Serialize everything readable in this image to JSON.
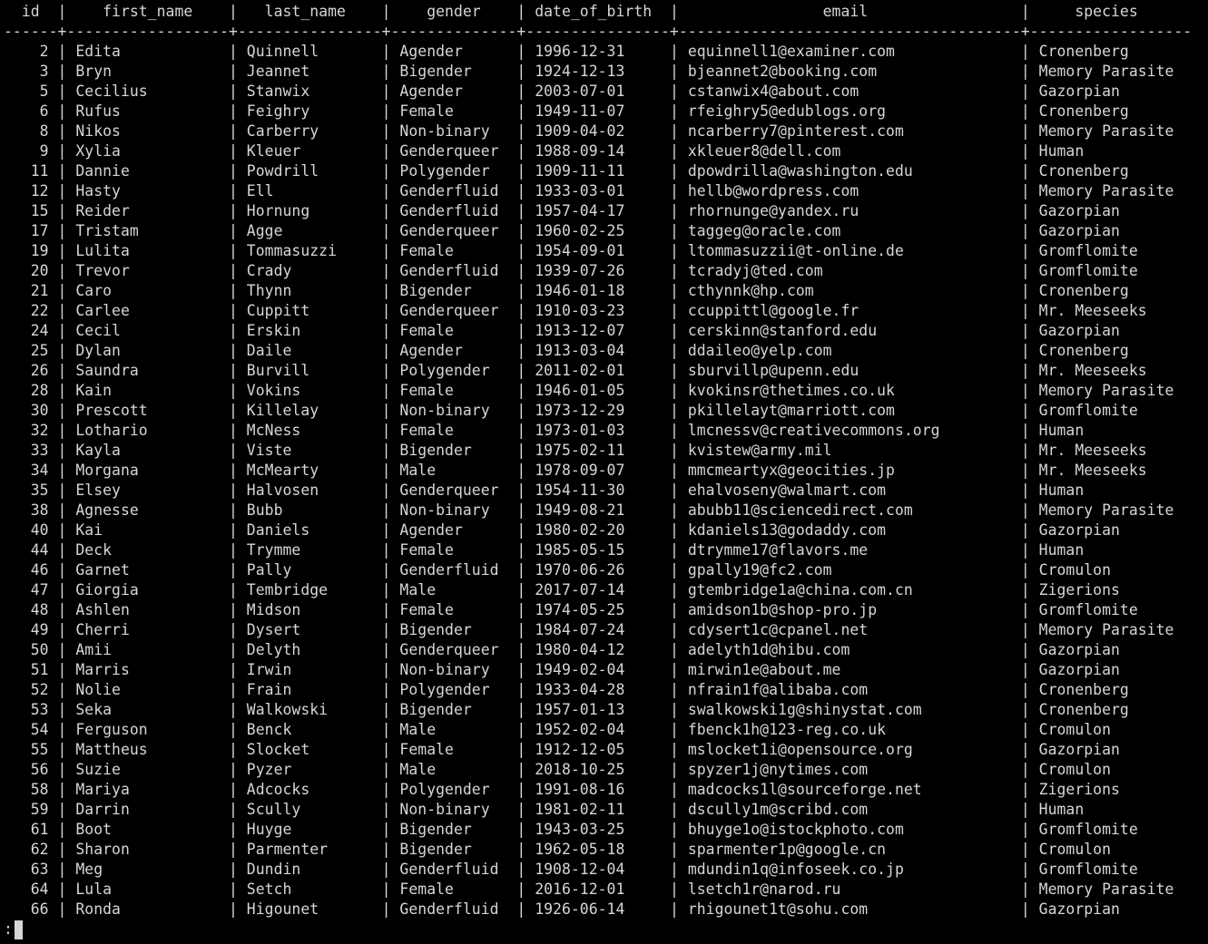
{
  "terminal": {
    "prompt": ":",
    "colors": {
      "background": "#000000",
      "text": "#d6d6d6"
    }
  },
  "table": {
    "columns": [
      {
        "key": "id",
        "label": "id",
        "width": 6,
        "align": "right"
      },
      {
        "key": "first_name",
        "label": "first_name",
        "width": 18,
        "align": "left"
      },
      {
        "key": "last_name",
        "label": "last_name",
        "width": 16,
        "align": "left"
      },
      {
        "key": "gender",
        "label": "gender",
        "width": 14,
        "align": "left"
      },
      {
        "key": "date_of_birth",
        "label": "date_of_birth",
        "width": 16,
        "align": "left"
      },
      {
        "key": "email",
        "label": "email",
        "width": 38,
        "align": "left"
      },
      {
        "key": "species",
        "label": "species",
        "width": 18,
        "align": "left"
      }
    ],
    "rows": [
      [
        "2",
        "Edita",
        "Quinnell",
        "Agender",
        "1996-12-31",
        "equinnell1@examiner.com",
        "Cronenberg"
      ],
      [
        "3",
        "Bryn",
        "Jeannet",
        "Bigender",
        "1924-12-13",
        "bjeannet2@booking.com",
        "Memory Parasite"
      ],
      [
        "5",
        "Cecilius",
        "Stanwix",
        "Agender",
        "2003-07-01",
        "cstanwix4@about.com",
        "Gazorpian"
      ],
      [
        "6",
        "Rufus",
        "Feighry",
        "Female",
        "1949-11-07",
        "rfeighry5@edublogs.org",
        "Cronenberg"
      ],
      [
        "8",
        "Nikos",
        "Carberry",
        "Non-binary",
        "1909-04-02",
        "ncarberry7@pinterest.com",
        "Memory Parasite"
      ],
      [
        "9",
        "Xylia",
        "Kleuer",
        "Genderqueer",
        "1988-09-14",
        "xkleuer8@dell.com",
        "Human"
      ],
      [
        "11",
        "Dannie",
        "Powdrill",
        "Polygender",
        "1909-11-11",
        "dpowdrilla@washington.edu",
        "Cronenberg"
      ],
      [
        "12",
        "Hasty",
        "Ell",
        "Genderfluid",
        "1933-03-01",
        "hellb@wordpress.com",
        "Memory Parasite"
      ],
      [
        "15",
        "Reider",
        "Hornung",
        "Genderfluid",
        "1957-04-17",
        "rhornunge@yandex.ru",
        "Gazorpian"
      ],
      [
        "17",
        "Tristam",
        "Agge",
        "Genderqueer",
        "1960-02-25",
        "taggeg@oracle.com",
        "Gazorpian"
      ],
      [
        "19",
        "Lulita",
        "Tommasuzzi",
        "Female",
        "1954-09-01",
        "ltommasuzzii@t-online.de",
        "Gromflomite"
      ],
      [
        "20",
        "Trevor",
        "Crady",
        "Genderfluid",
        "1939-07-26",
        "tcradyj@ted.com",
        "Gromflomite"
      ],
      [
        "21",
        "Caro",
        "Thynn",
        "Bigender",
        "1946-01-18",
        "cthynnk@hp.com",
        "Cronenberg"
      ],
      [
        "22",
        "Carlee",
        "Cuppitt",
        "Genderqueer",
        "1910-03-23",
        "ccuppittl@google.fr",
        "Mr. Meeseeks"
      ],
      [
        "24",
        "Cecil",
        "Erskin",
        "Female",
        "1913-12-07",
        "cerskinn@stanford.edu",
        "Gazorpian"
      ],
      [
        "25",
        "Dylan",
        "Daile",
        "Agender",
        "1913-03-04",
        "ddaileo@yelp.com",
        "Cronenberg"
      ],
      [
        "26",
        "Saundra",
        "Burvill",
        "Polygender",
        "2011-02-01",
        "sburvillp@upenn.edu",
        "Mr. Meeseeks"
      ],
      [
        "28",
        "Kain",
        "Vokins",
        "Female",
        "1946-01-05",
        "kvokinsr@thetimes.co.uk",
        "Memory Parasite"
      ],
      [
        "30",
        "Prescott",
        "Killelay",
        "Non-binary",
        "1973-12-29",
        "pkillelayt@marriott.com",
        "Gromflomite"
      ],
      [
        "32",
        "Lothario",
        "McNess",
        "Female",
        "1973-01-03",
        "lmcnessv@creativecommons.org",
        "Human"
      ],
      [
        "33",
        "Kayla",
        "Viste",
        "Bigender",
        "1975-02-11",
        "kvistew@army.mil",
        "Mr. Meeseeks"
      ],
      [
        "34",
        "Morgana",
        "McMearty",
        "Male",
        "1978-09-07",
        "mmcmeartyx@geocities.jp",
        "Mr. Meeseeks"
      ],
      [
        "35",
        "Elsey",
        "Halvosen",
        "Genderqueer",
        "1954-11-30",
        "ehalvoseny@walmart.com",
        "Human"
      ],
      [
        "38",
        "Agnesse",
        "Bubb",
        "Non-binary",
        "1949-08-21",
        "abubb11@sciencedirect.com",
        "Memory Parasite"
      ],
      [
        "40",
        "Kai",
        "Daniels",
        "Agender",
        "1980-02-20",
        "kdaniels13@godaddy.com",
        "Gazorpian"
      ],
      [
        "44",
        "Deck",
        "Trymme",
        "Female",
        "1985-05-15",
        "dtrymme17@flavors.me",
        "Human"
      ],
      [
        "46",
        "Garnet",
        "Pally",
        "Genderfluid",
        "1970-06-26",
        "gpally19@fc2.com",
        "Cromulon"
      ],
      [
        "47",
        "Giorgia",
        "Tembridge",
        "Male",
        "2017-07-14",
        "gtembridge1a@china.com.cn",
        "Zigerions"
      ],
      [
        "48",
        "Ashlen",
        "Midson",
        "Female",
        "1974-05-25",
        "amidson1b@shop-pro.jp",
        "Gromflomite"
      ],
      [
        "49",
        "Cherri",
        "Dysert",
        "Bigender",
        "1984-07-24",
        "cdysert1c@cpanel.net",
        "Memory Parasite"
      ],
      [
        "50",
        "Amii",
        "Delyth",
        "Genderqueer",
        "1980-04-12",
        "adelyth1d@hibu.com",
        "Gazorpian"
      ],
      [
        "51",
        "Marris",
        "Irwin",
        "Non-binary",
        "1949-02-04",
        "mirwin1e@about.me",
        "Gazorpian"
      ],
      [
        "52",
        "Nolie",
        "Frain",
        "Polygender",
        "1933-04-28",
        "nfrain1f@alibaba.com",
        "Cronenberg"
      ],
      [
        "53",
        "Seka",
        "Walkowski",
        "Bigender",
        "1957-01-13",
        "swalkowski1g@shinystat.com",
        "Cronenberg"
      ],
      [
        "54",
        "Ferguson",
        "Benck",
        "Male",
        "1952-02-04",
        "fbenck1h@123-reg.co.uk",
        "Cromulon"
      ],
      [
        "55",
        "Mattheus",
        "Slocket",
        "Female",
        "1912-12-05",
        "mslocket1i@opensource.org",
        "Gazorpian"
      ],
      [
        "56",
        "Suzie",
        "Pyzer",
        "Male",
        "2018-10-25",
        "spyzer1j@nytimes.com",
        "Cromulon"
      ],
      [
        "58",
        "Mariya",
        "Adcocks",
        "Polygender",
        "1991-08-16",
        "madcocks1l@sourceforge.net",
        "Zigerions"
      ],
      [
        "59",
        "Darrin",
        "Scully",
        "Non-binary",
        "1981-02-11",
        "dscully1m@scribd.com",
        "Human"
      ],
      [
        "61",
        "Boot",
        "Huyge",
        "Bigender",
        "1943-03-25",
        "bhuyge1o@istockphoto.com",
        "Gromflomite"
      ],
      [
        "62",
        "Sharon",
        "Parmenter",
        "Bigender",
        "1962-05-18",
        "sparmenter1p@google.cn",
        "Cromulon"
      ],
      [
        "63",
        "Meg",
        "Dundin",
        "Genderfluid",
        "1908-12-04",
        "mdundin1q@infoseek.co.jp",
        "Gromflomite"
      ],
      [
        "64",
        "Lula",
        "Setch",
        "Female",
        "2016-12-01",
        "lsetch1r@narod.ru",
        "Memory Parasite"
      ],
      [
        "66",
        "Ronda",
        "Higounet",
        "Genderfluid",
        "1926-06-14",
        "rhigounet1t@sohu.com",
        "Gazorpian"
      ]
    ]
  }
}
